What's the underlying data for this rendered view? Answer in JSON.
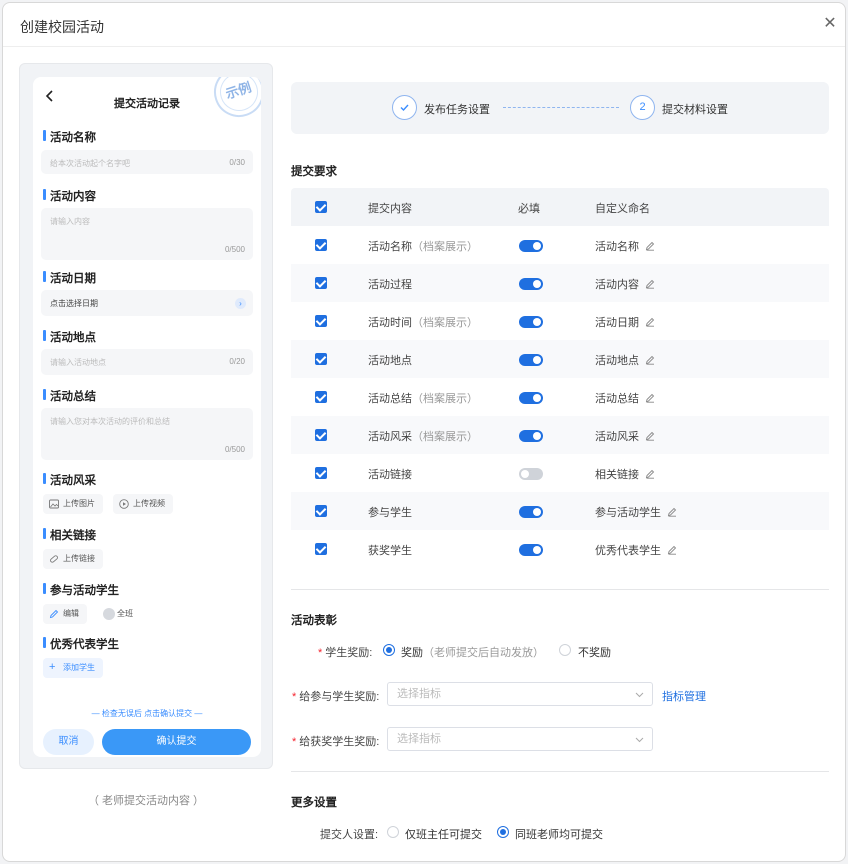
{
  "modal": {
    "title": "创建校园活动"
  },
  "preview": {
    "phone_title": "提交活动记录",
    "stamp": "示例",
    "sections": {
      "name": {
        "title": "活动名称",
        "placeholder": "给本次活动起个名字吧",
        "count": "0/30"
      },
      "content": {
        "title": "活动内容",
        "placeholder": "请输入内容",
        "count": "0/500"
      },
      "date": {
        "title": "活动日期",
        "placeholder": "点击选择日期"
      },
      "place": {
        "title": "活动地点",
        "placeholder": "请输入活动地点",
        "count": "0/20"
      },
      "summary": {
        "title": "活动总结",
        "placeholder": "请输入您对本次活动的评价和总结",
        "count": "0/500"
      },
      "photos": {
        "title": "活动风采",
        "upload_image": "上传图片",
        "upload_video": "上传视频"
      },
      "links": {
        "title": "相关链接",
        "upload_link": "上传链接"
      },
      "students": {
        "title": "参与活动学生",
        "edit": "编辑",
        "all_class": "全班"
      },
      "excellent": {
        "title": "优秀代表学生",
        "add": "添加学生"
      }
    },
    "bottom_tip": "— 检查无误后 点击确认提交 —",
    "cancel": "取消",
    "confirm": "确认提交",
    "caption": "（ 老师提交活动内容 ）"
  },
  "steps": [
    {
      "label": "发布任务设置",
      "state": "done"
    },
    {
      "num": "2",
      "label": "提交材料设置",
      "state": "active"
    }
  ],
  "requirements": {
    "heading": "提交要求",
    "headers": {
      "content": "提交内容",
      "required": "必填",
      "name": "自定义命名"
    },
    "rows": [
      {
        "content": "活动名称",
        "hint": "（档案展示）",
        "required": true,
        "name": "活动名称"
      },
      {
        "content": "活动过程",
        "hint": "",
        "required": true,
        "name": "活动内容"
      },
      {
        "content": "活动时间",
        "hint": "（档案展示）",
        "required": true,
        "name": "活动日期"
      },
      {
        "content": "活动地点",
        "hint": "",
        "required": true,
        "name": "活动地点"
      },
      {
        "content": "活动总结",
        "hint": "（档案展示）",
        "required": true,
        "name": "活动总结"
      },
      {
        "content": "活动风采",
        "hint": "（档案展示）",
        "required": true,
        "name": "活动风采"
      },
      {
        "content": "活动链接",
        "hint": "",
        "required": false,
        "name": "相关链接"
      },
      {
        "content": "参与学生",
        "hint": "",
        "required": true,
        "name": "参与活动学生"
      },
      {
        "content": "获奖学生",
        "hint": "",
        "required": true,
        "name": "优秀代表学生"
      }
    ]
  },
  "commend": {
    "heading": "活动表彰",
    "student_reward_label": "学生奖励:",
    "reward_yes": "奖励",
    "reward_yes_hint": "（老师提交后自动发放）",
    "reward_no": "不奖励",
    "participant_label": "给参与学生奖励:",
    "participant_placeholder": "选择指标",
    "indicator_link": "指标管理",
    "winner_label": "给获奖学生奖励:",
    "winner_placeholder": "选择指标"
  },
  "more": {
    "heading": "更多设置",
    "submitter_label": "提交人设置:",
    "option_head": "仅班主任可提交",
    "option_all": "同班老师均可提交"
  },
  "colors": {
    "primary": "#1f6fe0",
    "accent": "#3a98f7"
  }
}
